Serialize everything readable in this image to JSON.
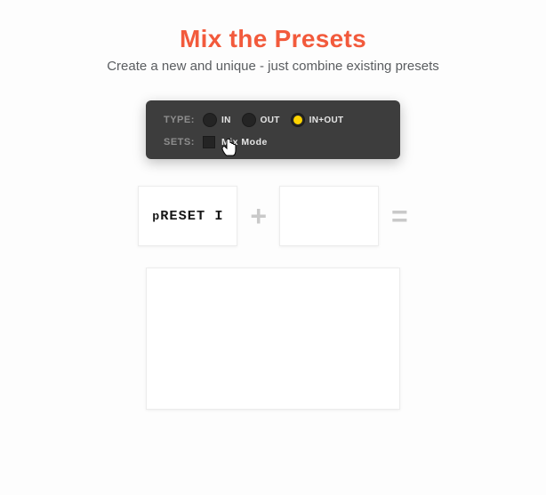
{
  "heading": "Mix the Presets",
  "subheading": "Create a new and unique - just combine existing presets",
  "panel": {
    "type_label": "TYPE:",
    "sets_label": "SETS:",
    "options": {
      "in": "IN",
      "out": "OUT",
      "inout": "IN+OUT"
    },
    "mixmode_label": "Mix Mode"
  },
  "equation": {
    "preset1_raw": "pRESET I",
    "preset2": "",
    "plus": "+",
    "equals": "="
  }
}
